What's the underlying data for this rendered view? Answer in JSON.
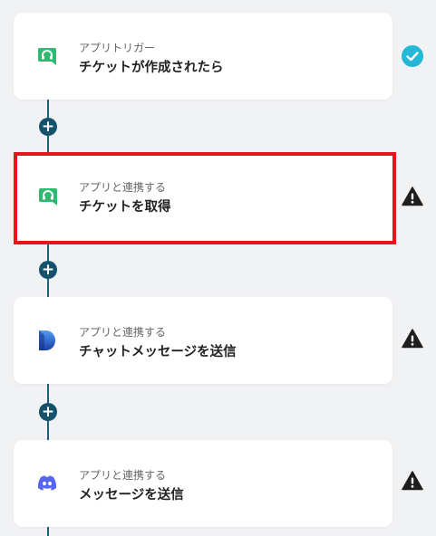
{
  "steps": [
    {
      "type_label": "アプリトリガー",
      "title": "チケットが作成されたら",
      "icon": "support-headset-icon",
      "status": "check-circle-icon"
    },
    {
      "type_label": "アプリと連携する",
      "title": "チケットを取得",
      "icon": "support-headset-icon",
      "status": "warning-icon"
    },
    {
      "type_label": "アプリと連携する",
      "title": "チャットメッセージを送信",
      "icon": "chat-app-d-logo-icon",
      "status": "warning-icon"
    },
    {
      "type_label": "アプリと連携する",
      "title": "メッセージを送信",
      "icon": "discord-icon",
      "status": "warning-icon"
    }
  ],
  "add_step_symbol": "+",
  "colors": {
    "accent_check": "#24b8d6",
    "connector": "#14516b",
    "selected_border": "#e8141c",
    "support_green": "#2fba6f",
    "discord": "#5865f2",
    "warning": "#1e1e1e"
  }
}
